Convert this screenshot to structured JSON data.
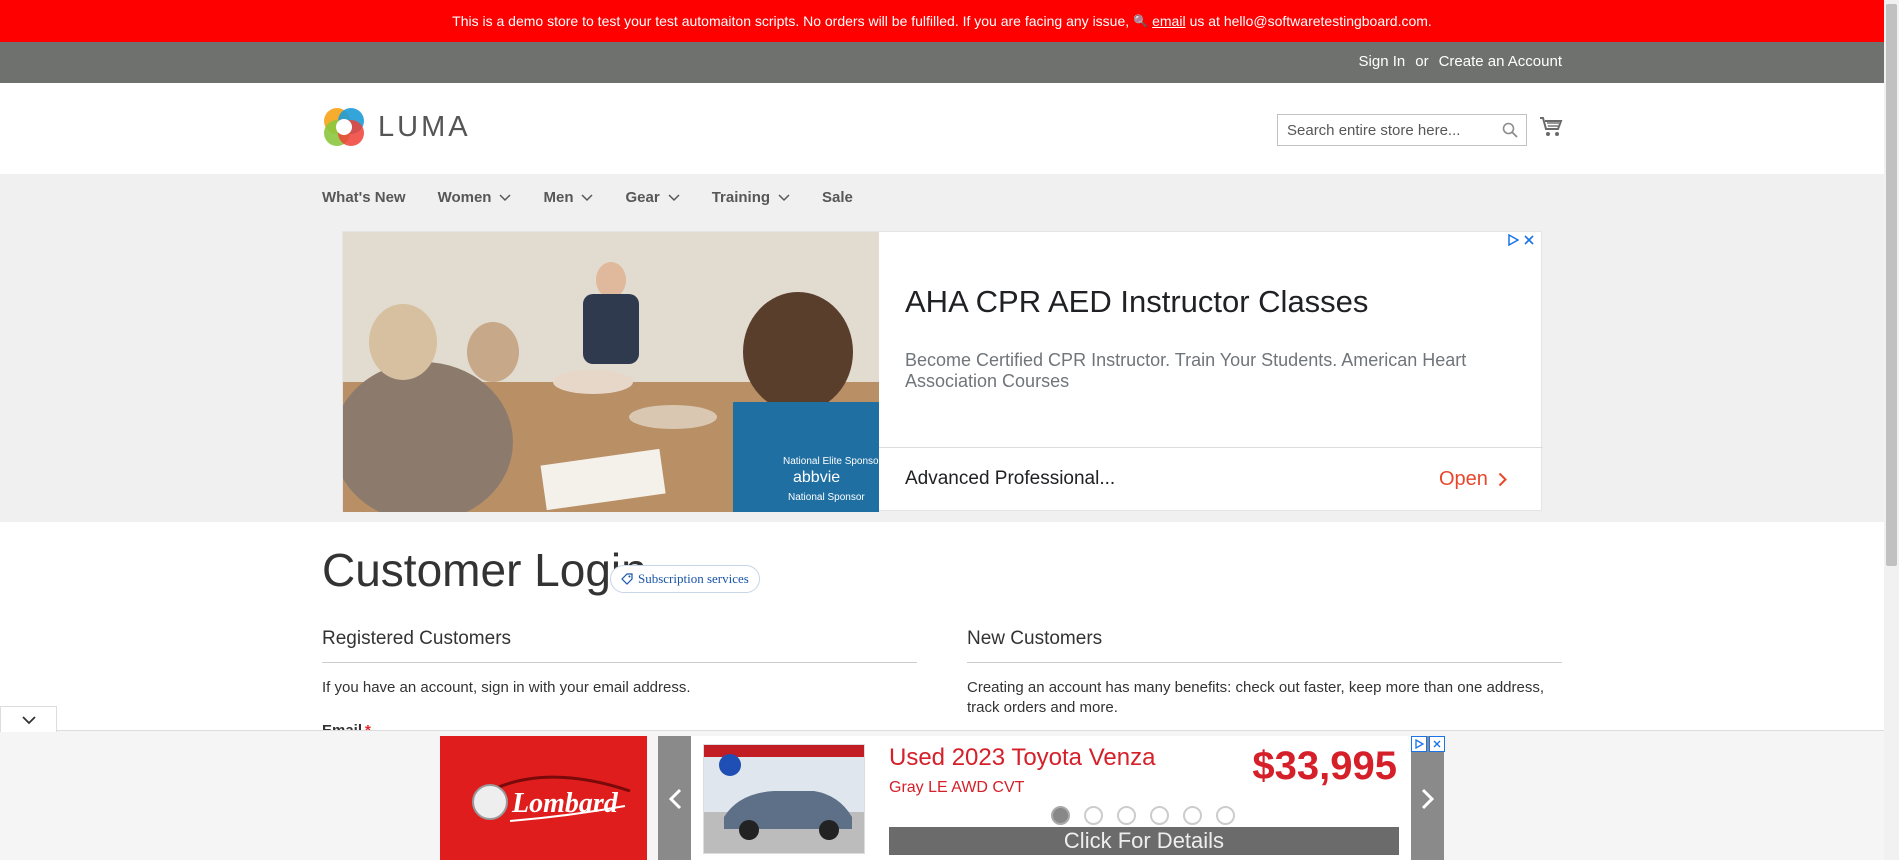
{
  "demo_notice": {
    "text_before": "This is a demo store to test your test automaiton scripts. No orders will be fulfilled. If you are facing any issue,",
    "link": "email",
    "text_after": "us at hello@softwaretestingboard.com."
  },
  "header": {
    "sign_in": "Sign In",
    "or": "or",
    "create_account": "Create an Account"
  },
  "logo": {
    "text": "LUMA"
  },
  "search": {
    "placeholder": "Search entire store here..."
  },
  "nav": {
    "items": [
      {
        "label": "What's New",
        "has_dropdown": false
      },
      {
        "label": "Women",
        "has_dropdown": true
      },
      {
        "label": "Men",
        "has_dropdown": true
      },
      {
        "label": "Gear",
        "has_dropdown": true
      },
      {
        "label": "Training",
        "has_dropdown": true
      },
      {
        "label": "Sale",
        "has_dropdown": false
      }
    ]
  },
  "ad": {
    "title": "AHA CPR AED Instructor Classes",
    "description": "Become Certified CPR Instructor. Train Your Students. American Heart Association Courses",
    "footer_text": "Advanced Professional...",
    "cta": "Open",
    "photo_text": "National Elite Sponsor abbvie National Sponsor"
  },
  "page": {
    "title": "Customer Login",
    "subscription_pill": "Subscription services"
  },
  "registered": {
    "heading": "Registered Customers",
    "intro": "If you have an account, sign in with your email address.",
    "email_label": "Email",
    "required_mark": "*"
  },
  "new_customers": {
    "heading": "New Customers",
    "intro": "Creating an account has many benefits: check out faster, keep more than one address, track orders and more."
  },
  "bottom_ad": {
    "brand": "Lombard",
    "title": "Used 2023 Toyota Venza",
    "subtitle": "Gray LE AWD CVT",
    "price": "$33,995",
    "cta": "Click For Details",
    "slide_count": 6,
    "active_slide": 1
  },
  "colors": {
    "demo_bar": "#ff0000",
    "header_panel": "#6e716e",
    "nav_bg": "#f0f0f0",
    "ad_cta": "#e8472c",
    "car_red": "#d5202a"
  }
}
